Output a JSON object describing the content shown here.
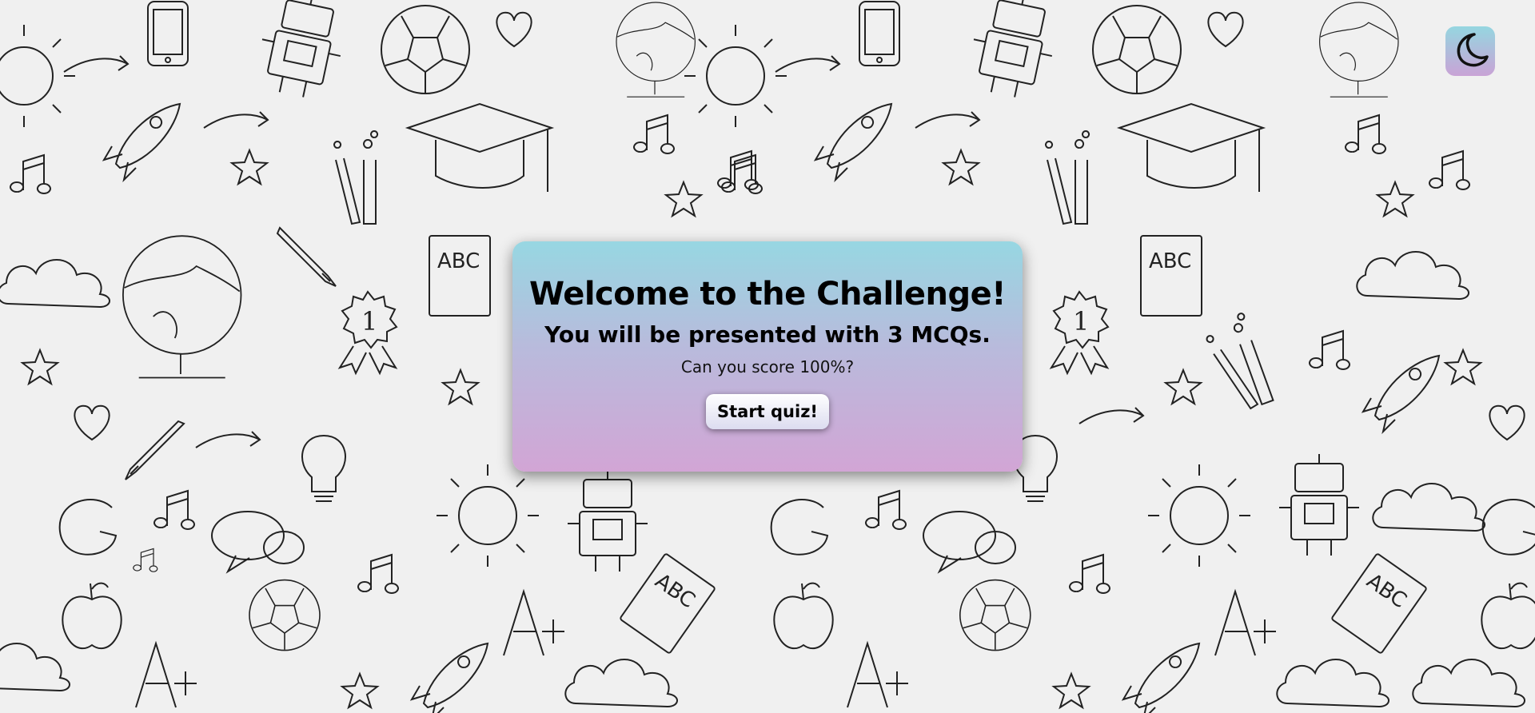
{
  "theme_toggle": {
    "icon": "moon-icon"
  },
  "card": {
    "title": "Welcome to the Challenge!",
    "subtitle": "You will be presented with 3 MCQs.",
    "question": "Can you score 100%?",
    "start_label": "Start quiz!"
  },
  "colors": {
    "card_top": "#97d7e2",
    "card_bottom": "#d2a5d5",
    "background": "#f0f0f0"
  }
}
